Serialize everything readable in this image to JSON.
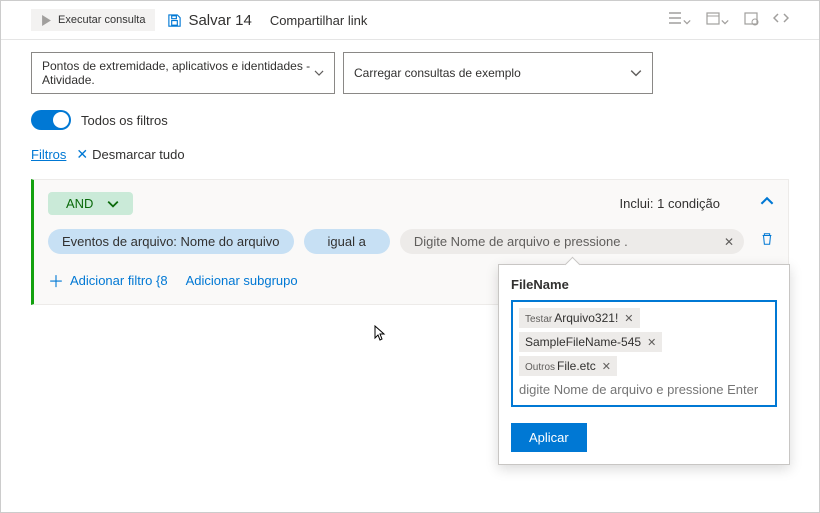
{
  "toolbar": {
    "run_label": "Executar consulta",
    "save_label": "Salvar 14",
    "share_label": "Compartilhar link"
  },
  "dropdowns": {
    "scope": "Pontos de extremidade, aplicativos e identidades - Atividade.",
    "sample": "Carregar consultas de exemplo"
  },
  "filters": {
    "all_label": "Todos os filtros",
    "filters_link": "Filtros",
    "clear_label": "Desmarcar tudo"
  },
  "panel": {
    "operator": "AND",
    "includes": "Inclui: 1 condição",
    "field_pill": "Eventos de arquivo: Nome do arquivo",
    "op_pill": "igual a",
    "value_pill": "Digite Nome de arquivo e pressione .",
    "add_filter": "Adicionar filtro {8",
    "add_subgroup": "Adicionar subgrupo"
  },
  "popup": {
    "title": "FileName",
    "chips": [
      {
        "prefix": "Testar",
        "text": "Arquivo321!"
      },
      {
        "prefix": "",
        "text": "SampleFileName-545"
      },
      {
        "prefix": "Outros",
        "text": "File.etc"
      }
    ],
    "placeholder": "digite Nome de arquivo e pressione Enter",
    "apply": "Aplicar"
  }
}
